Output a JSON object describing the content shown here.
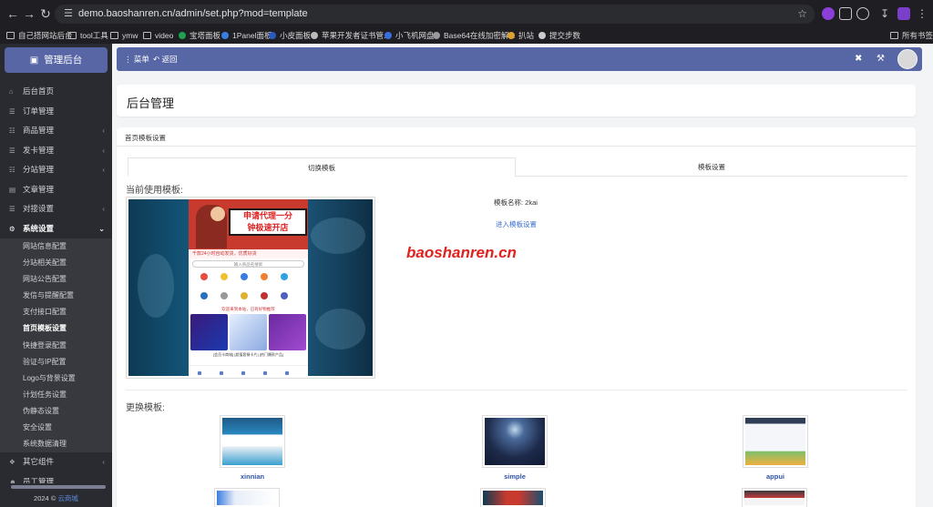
{
  "browser": {
    "url": "demo.baoshanren.cn/admin/set.php?mod=template",
    "bookmarks": [
      "自己搭网站后台",
      "tool工具",
      "ymw",
      "video",
      "宝塔面板",
      "1Panel面板",
      "小皮面板",
      "苹果开发者证书管...",
      "小飞机网盘",
      "Base64在线加密解...",
      "扒站",
      "提交步数"
    ],
    "all_bookmarks": "所有书签"
  },
  "sidebar": {
    "brand": "管理后台",
    "items": [
      {
        "label": "后台首页"
      },
      {
        "label": "订单管理"
      },
      {
        "label": "商品管理"
      },
      {
        "label": "发卡管理"
      },
      {
        "label": "分站管理"
      },
      {
        "label": "文章管理"
      },
      {
        "label": "对接设置"
      },
      {
        "label": "系统设置"
      }
    ],
    "sub_items": [
      "网站信息配置",
      "分站相关配置",
      "网站公告配置",
      "发信与提醒配置",
      "支付接口配置",
      "首页模板设置",
      "快捷登录配置",
      "验证与IP配置",
      "Logo与背景设置",
      "计划任务设置",
      "伪静态设置",
      "安全设置",
      "系统数据清理"
    ],
    "bottom_items": [
      {
        "label": "其它组件"
      },
      {
        "label": "员工管理"
      }
    ],
    "footer_year": "2024 ©",
    "footer_link": "云商城"
  },
  "topbar": {
    "menu_label": "菜单",
    "back_label": "返回"
  },
  "page": {
    "title": "后台管理",
    "panel_title": "首页模板设置",
    "tabs": [
      "切换模板",
      "模板设置"
    ],
    "current_label": "当前使用模板:",
    "template_name": "模板名称: 2kai",
    "enter_settings": "进入模板设置",
    "watermark": "baoshanren.cn",
    "change_label": "更换模板:",
    "templates": [
      {
        "name": "xinnian"
      },
      {
        "name": "simple"
      },
      {
        "name": "appui"
      }
    ]
  },
  "preview": {
    "banner_text_1": "申请代理一分",
    "banner_text_2": "钟极速开店",
    "strip": "千款24小时自动发货，优质好货",
    "search": "输入商品名搜索",
    "promo": "欢迎来到本站，已有好物推荐",
    "card_labels": "[会员卡商城]  [超值套餐卡片]  [热门爆款产品]"
  },
  "colors": {
    "brand": "#5866a6",
    "sidebar": "#2a2b31",
    "watermark": "#e0211e",
    "link": "#3a6fd0"
  }
}
